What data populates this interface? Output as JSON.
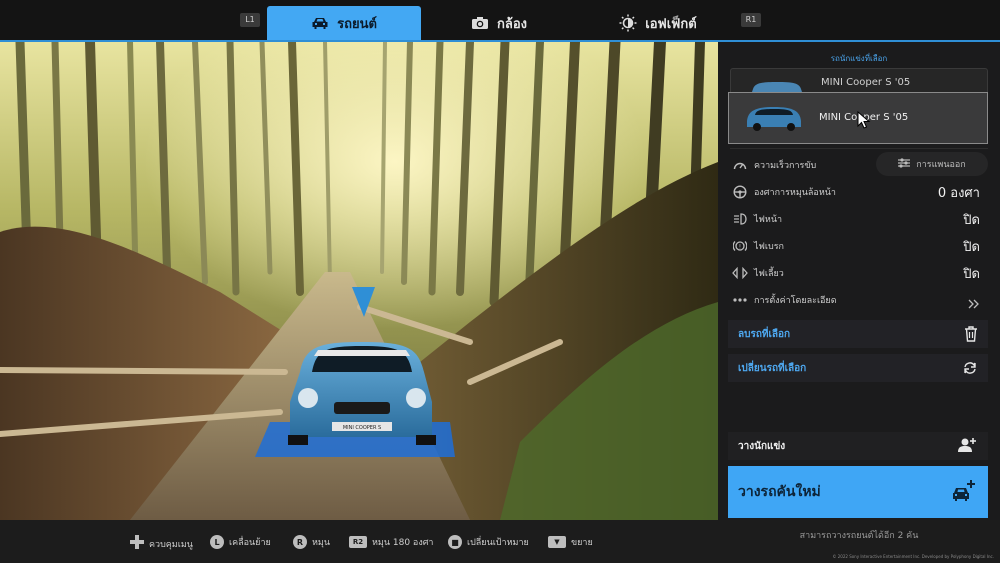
{
  "topbar": {
    "left_shoulder": "L1",
    "right_shoulder": "R1",
    "tabs": [
      {
        "label": "รถยนต์",
        "icon": "car-icon",
        "active": true
      },
      {
        "label": "กล้อง",
        "icon": "camera-icon",
        "active": false
      },
      {
        "label": "เอฟเฟ็กต์",
        "icon": "brightness-icon",
        "active": false
      }
    ]
  },
  "panel": {
    "header": "รถนักแข่งที่เลือก",
    "back_card_name": "MINI Cooper S '05",
    "selected_car": {
      "name": "MINI Cooper S '05",
      "color": "#3a7fb3"
    },
    "settings": {
      "driving_speed_label": "ความเร็วการขับ",
      "layout_button_label": "การแพนออก",
      "wheel_angle_label": "องศาการหมุนล้อหน้า",
      "wheel_angle_value": "0 องศา",
      "headlights_label": "ไฟหน้า",
      "headlights_value": "ปิด",
      "brake_lights_label": "ไฟเบรก",
      "brake_lights_value": "ปิด",
      "turn_signal_label": "ไฟเลี้ยว",
      "turn_signal_value": "ปิด",
      "detail_settings_label": "การตั้งค่าโดยละเอียด"
    },
    "actions": {
      "delete_label": "ลบรถที่เลือก",
      "change_label": "เปลี่ยนรถที่เลือก",
      "place_racer_label": "วางนักแข่ง",
      "place_new_car_label": "วางรถคันใหม่"
    },
    "remaining_text": "สามารถวางรถยนต์ได้อีก 2 คัน"
  },
  "scene": {
    "plate_text": "MINI COOPER S"
  },
  "bottombar": {
    "hints": [
      {
        "button": "✥",
        "label": "ควบคุมเมนู"
      },
      {
        "button": "L",
        "label": "เคลื่อนย้าย"
      },
      {
        "button": "R",
        "label": "หมุน"
      },
      {
        "button": "R2",
        "label": "หมุน 180 องศา"
      },
      {
        "button": "■",
        "label": "เปลี่ยนเป้าหมาย"
      },
      {
        "button": "▼",
        "label": "ขยาย"
      }
    ],
    "copyright": "© 2022 Sony Interactive Entertainment Inc. Developed by Polyphony Digital Inc."
  },
  "colors": {
    "accent": "#43a8f3",
    "accent_text": "#4ea8f0",
    "panel_bg": "#1b1b1c",
    "car_body": "#3a7fb3"
  }
}
